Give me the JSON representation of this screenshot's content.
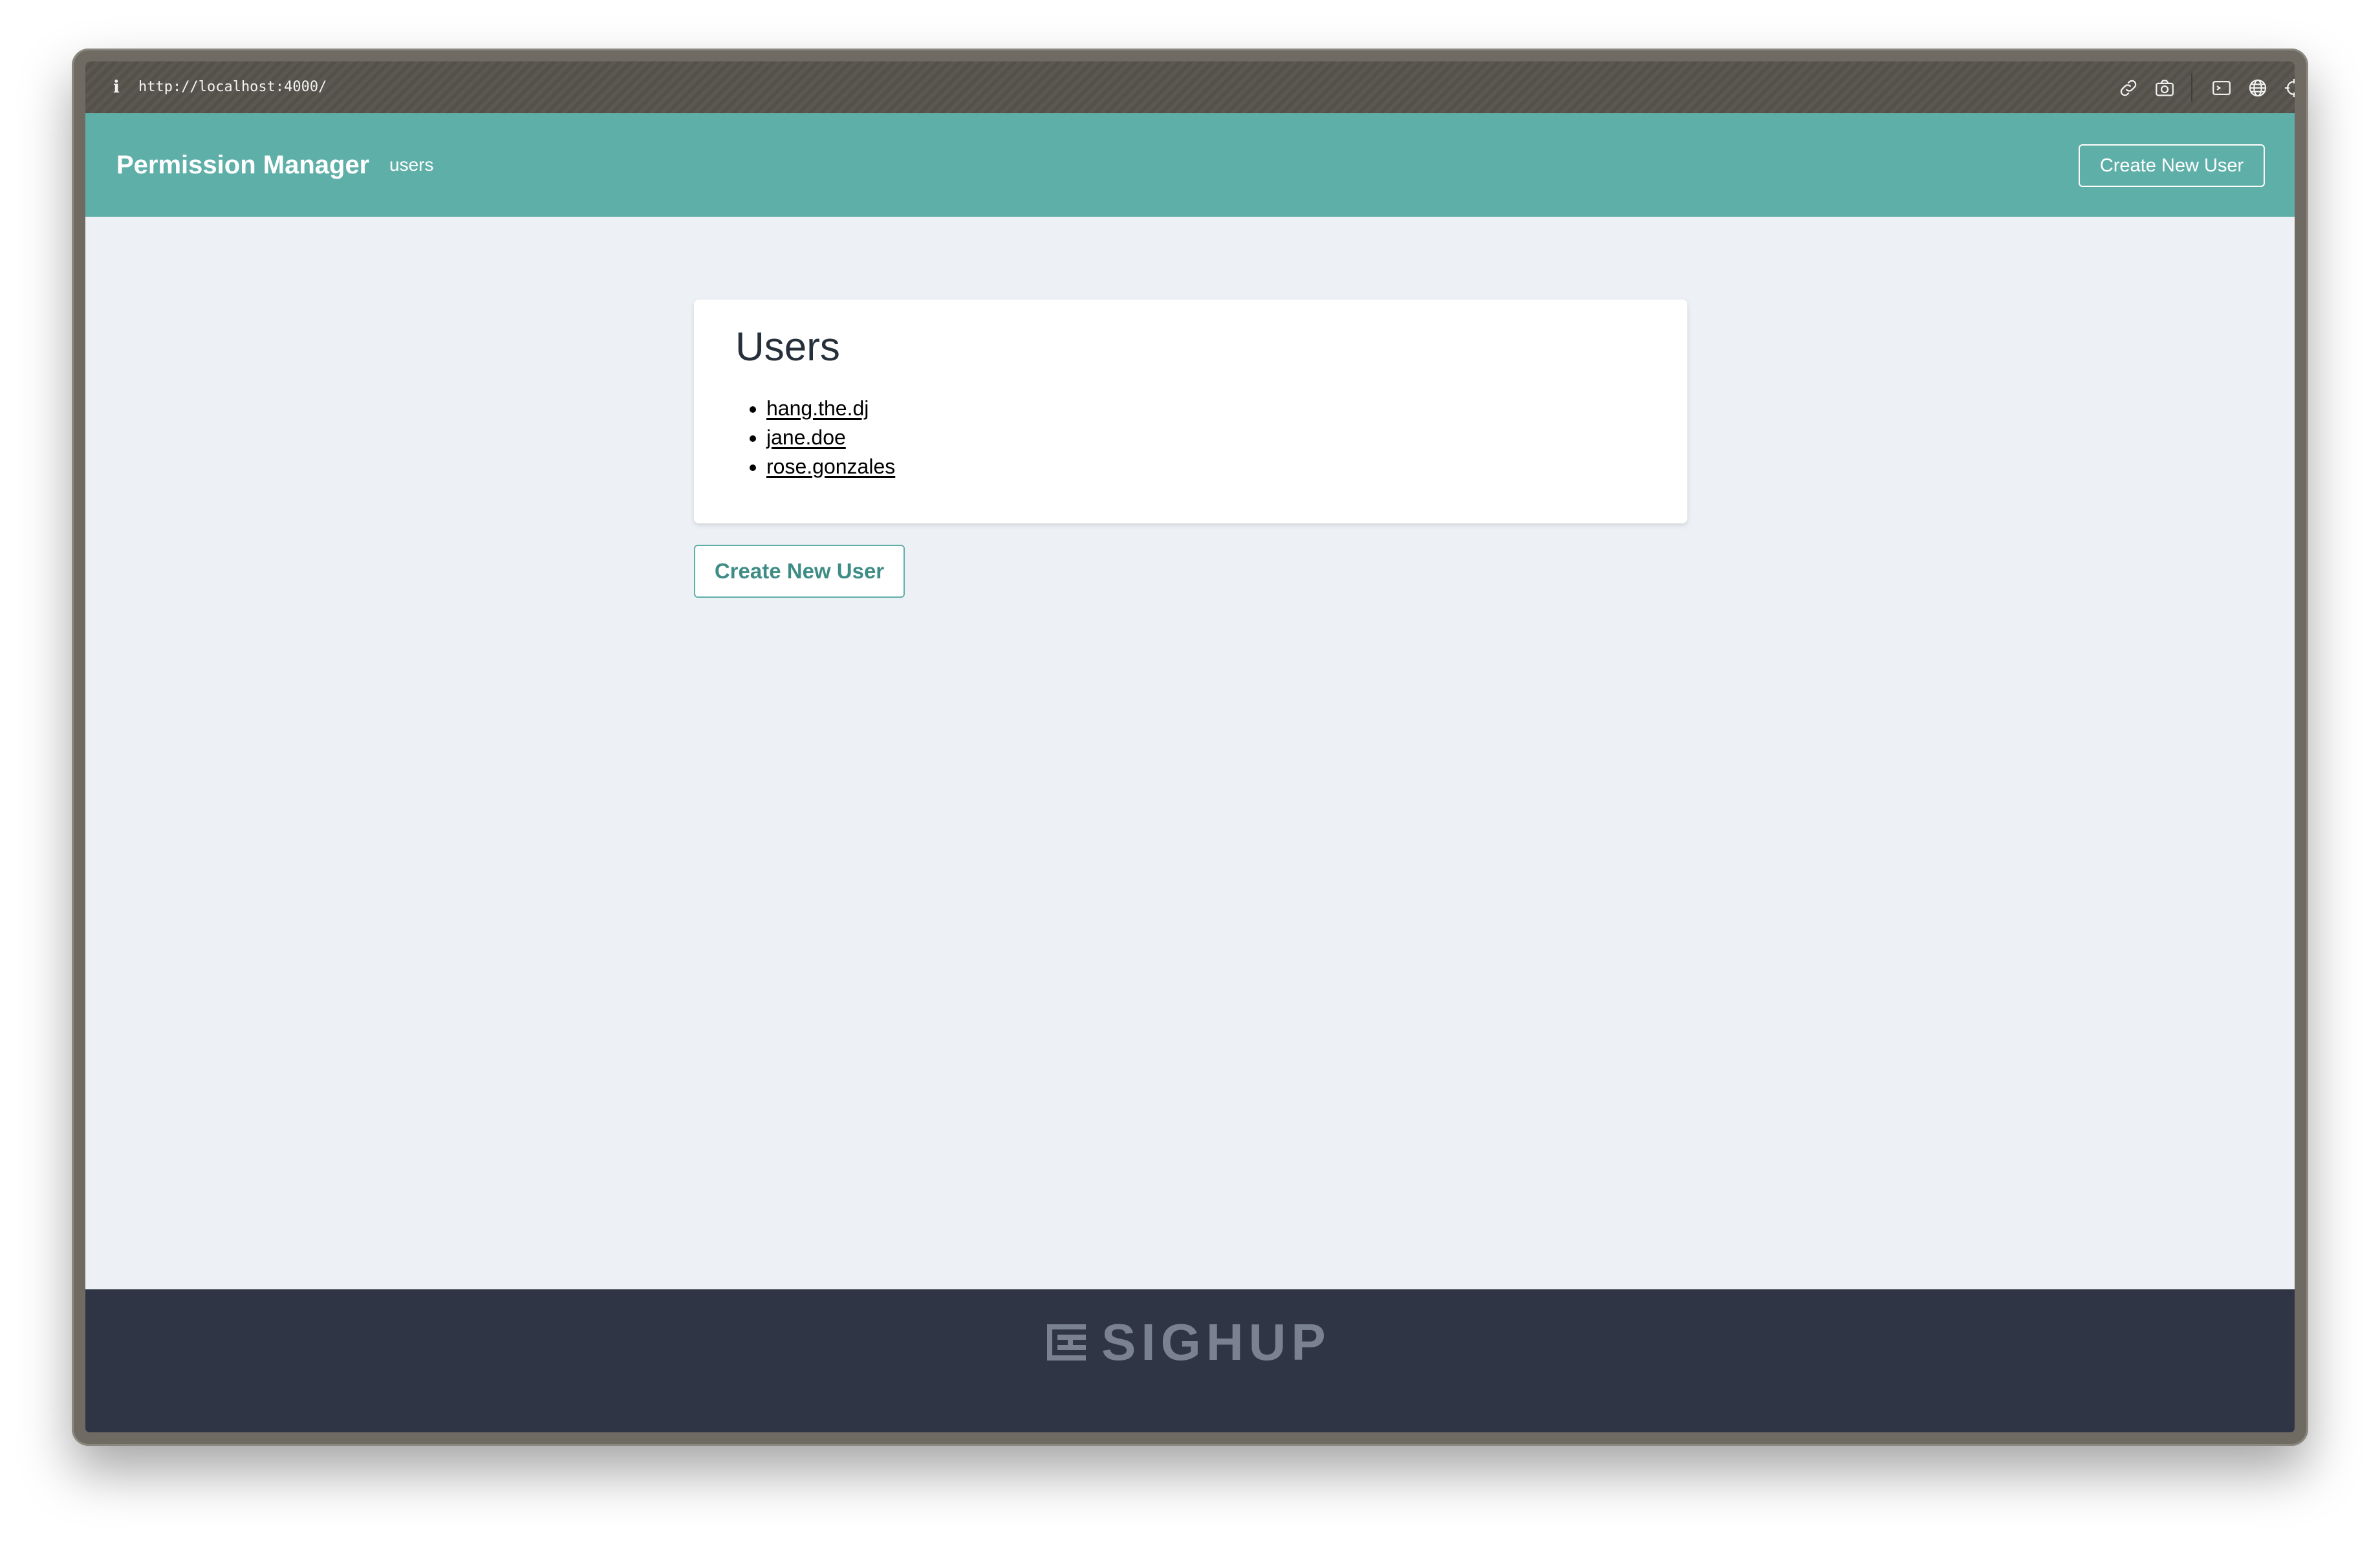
{
  "browser": {
    "url": "http://localhost:4000/",
    "icons": [
      "info-icon",
      "link-icon",
      "camera-icon",
      "terminal-icon",
      "globe-icon",
      "crosshair-icon",
      "export-icon",
      "split-view-icon"
    ]
  },
  "header": {
    "brand": "Permission Manager",
    "nav_users": "users",
    "create_button": "Create New User",
    "background_color": "#5fafa9"
  },
  "users_card": {
    "title": "Users",
    "users": [
      "hang.the.dj",
      "jane.doe",
      "rose.gonzales"
    ]
  },
  "main": {
    "create_button": "Create New User"
  },
  "footer": {
    "logo_text": "SIGHUP",
    "background_color": "#2f3545"
  }
}
